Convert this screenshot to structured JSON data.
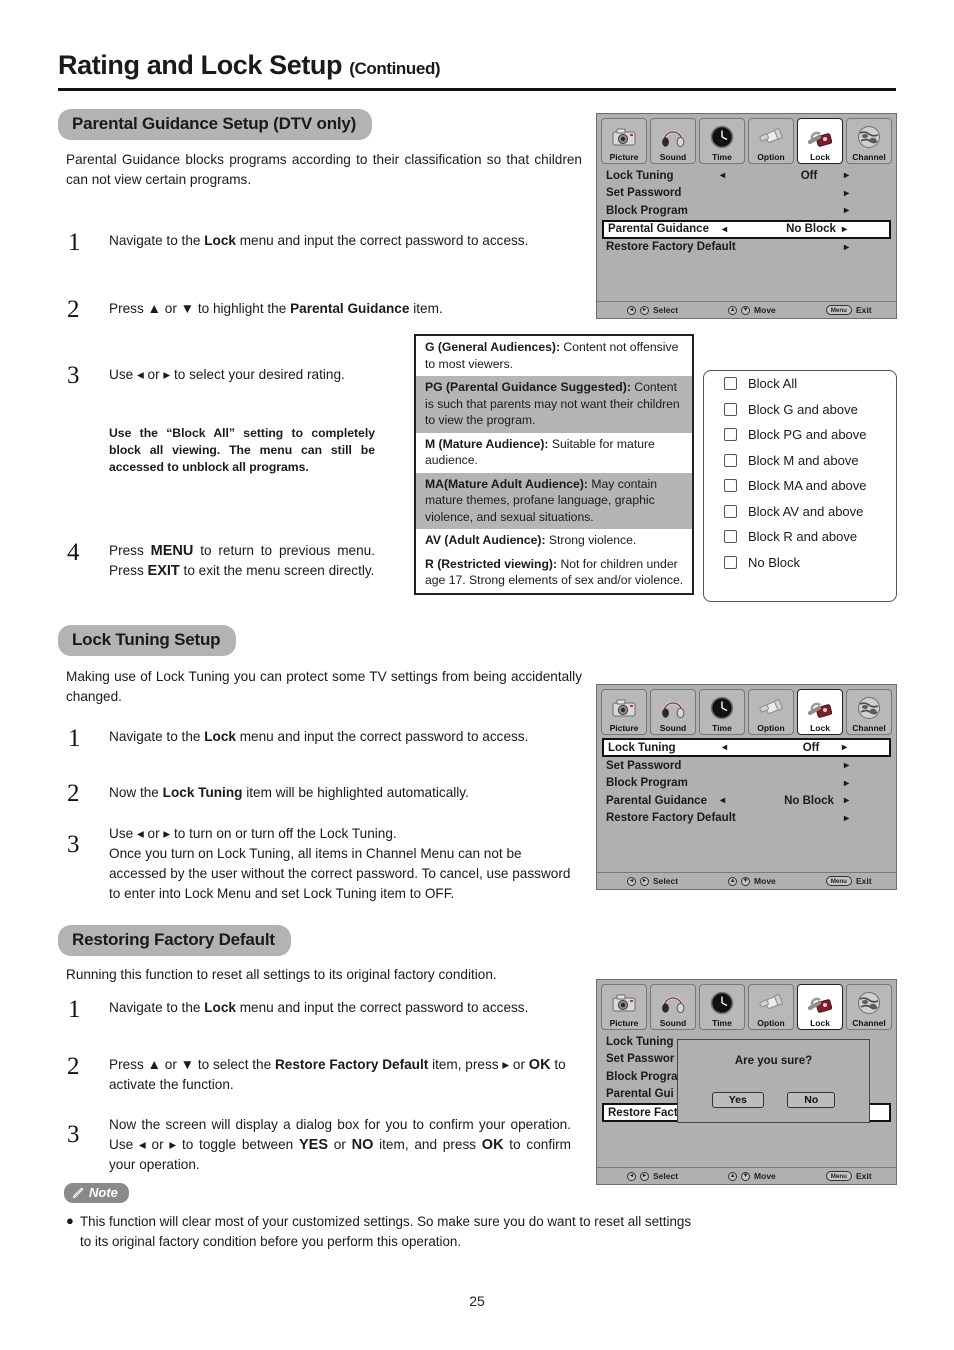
{
  "header": {
    "title": "Rating and Lock Setup",
    "continued": "(Continued)"
  },
  "page_number": "25",
  "sections": {
    "parental": {
      "heading": "Parental Guidance Setup (DTV only)",
      "intro": "Parental Guidance blocks programs according to their classification so that children can not view certain programs.",
      "steps": [
        {
          "num": "1",
          "text_html": "Navigate to the <b>Lock</b> menu and input the correct password to access."
        },
        {
          "num": "2",
          "text_html": "Press ▲ or ▼ to highlight the <b>Parental Guidance</b> item."
        },
        {
          "num": "3",
          "text_html": "Use ◂ or ▸ to select your desired rating."
        },
        {
          "num": "4",
          "text_html": "Press <span class=\"bigb\">MENU</span> to return to previous menu. Press <span class=\"bigb\">EXIT</span> to exit the menu screen directly."
        }
      ],
      "step3_note": "Use the “Block All” setting to completely block all viewing. The menu can still be accessed to unblock all programs."
    },
    "lock_tuning": {
      "heading": "Lock Tuning Setup",
      "intro": "Making use of Lock Tuning you can protect some TV settings from being accidentally changed.",
      "steps": [
        {
          "num": "1",
          "text_html": "Navigate to the <b>Lock</b> menu and input the correct password to access."
        },
        {
          "num": "2",
          "text_html": "Now the <b>Lock Tuning</b> item will be highlighted automatically."
        },
        {
          "num": "3",
          "text_html": "Use ◂ or ▸ to turn on or turn off the Lock Tuning.<br>Once you turn on Lock Tuning, all items in Channel Menu can not be accessed by the user without the correct password. To cancel, use password to enter into Lock Menu and set Lock Tuning item to OFF."
        }
      ]
    },
    "restore": {
      "heading": "Restoring Factory Default",
      "intro": "Running this function to reset all settings to its original factory condition.",
      "steps": [
        {
          "num": "1",
          "text_html": "Navigate to the <b>Lock</b> menu and input the correct password to access."
        },
        {
          "num": "2",
          "text_html": "Press ▲ or ▼ to select the <b>Restore Factory Default</b> item, press ▸ or <span class=\"bigb\">OK</span> to activate the function."
        },
        {
          "num": "3",
          "text_html": "Now the screen will display a dialog box for you to confirm your operation. Use ◂ or ▸ to toggle between <span class=\"bigb\">YES</span> or <span class=\"bigb\">NO</span> item, and press <span class=\"bigb\">OK</span> to confirm your operation."
        }
      ]
    }
  },
  "ratings": [
    {
      "term": "G (General Audiences):",
      "desc": "Content not offensive to most viewers.",
      "shade": false,
      "indent": false
    },
    {
      "term": "PG (Parental Guidance Suggested):",
      "desc": "Content is such that parents may not want their children to view the program.",
      "shade": true,
      "indent": true
    },
    {
      "term": "M (Mature Audience):",
      "desc": "Suitable for mature audience.",
      "shade": false,
      "indent": false
    },
    {
      "term": "MA(Mature Adult Audience):",
      "desc": "May contain mature themes, profane language, graphic violence, and sexual situations.",
      "shade": true,
      "indent": true
    },
    {
      "term": "AV (Adult Audience):",
      "desc": "Strong violence.",
      "shade": false,
      "indent": false
    },
    {
      "term": "R (Restricted viewing):",
      "desc": "Not for children under age 17. Strong elements of sex and/or violence.",
      "shade": false,
      "indent": true
    }
  ],
  "block_options": [
    "Block All",
    "Block G and above",
    "Block PG and above",
    "Block M and above",
    "Block MA and above",
    "Block AV and above",
    "Block R and above",
    "No Block"
  ],
  "osd": {
    "tabs": [
      {
        "label": "Picture",
        "icon": "camera-icon",
        "active": false
      },
      {
        "label": "Sound",
        "icon": "headphones-icon",
        "active": false
      },
      {
        "label": "Time",
        "icon": "clock-icon",
        "active": false
      },
      {
        "label": "Option",
        "icon": "plug-icon",
        "active": false
      },
      {
        "label": "Lock",
        "icon": "padlock-icon",
        "active": true
      },
      {
        "label": "Channel",
        "icon": "globe-icon",
        "active": false
      }
    ],
    "footer": {
      "select_label": "Select",
      "move_label": "Move",
      "exit_label": "Exit",
      "menu_key": "Menu",
      "left_key": "◂",
      "right_key": "▸",
      "up_key": "▲",
      "down_key": "▼"
    },
    "menu1": {
      "rows": [
        {
          "label": "Lock Tuning",
          "value": "Off",
          "arrows": true,
          "chevron": true,
          "highlight": false
        },
        {
          "label": "Set Password",
          "value": "",
          "arrows": false,
          "chevron": true,
          "highlight": false
        },
        {
          "label": "Block Program",
          "value": "",
          "arrows": false,
          "chevron": true,
          "highlight": false
        },
        {
          "label": "Parental Guidance",
          "value": "No Block",
          "arrows": true,
          "chevron": true,
          "highlight": true
        },
        {
          "label": "Restore Factory Default",
          "value": "",
          "arrows": false,
          "chevron": true,
          "highlight": false
        }
      ]
    },
    "menu2": {
      "rows": [
        {
          "label": "Lock Tuning",
          "value": "Off",
          "arrows": true,
          "chevron": true,
          "highlight": true
        },
        {
          "label": "Set Password",
          "value": "",
          "arrows": false,
          "chevron": true,
          "highlight": false
        },
        {
          "label": "Block Program",
          "value": "",
          "arrows": false,
          "chevron": true,
          "highlight": false
        },
        {
          "label": "Parental Guidance",
          "value": "No Block",
          "arrows": true,
          "chevron": true,
          "highlight": false
        },
        {
          "label": "Restore Factory Default",
          "value": "",
          "arrows": false,
          "chevron": true,
          "highlight": false
        }
      ]
    },
    "menu3": {
      "rows": [
        {
          "label": "Lock Tuning",
          "value": "",
          "arrows": false,
          "chevron": false,
          "highlight": false
        },
        {
          "label": "Set Passwor",
          "value": "",
          "arrows": false,
          "chevron": false,
          "highlight": false
        },
        {
          "label": "Block Progra",
          "value": "",
          "arrows": false,
          "chevron": false,
          "highlight": false
        },
        {
          "label": "Parental Gui",
          "value": "",
          "arrows": false,
          "chevron": false,
          "highlight": false
        },
        {
          "label": "Restore Fact",
          "value": "",
          "arrows": false,
          "chevron": false,
          "highlight": true
        }
      ],
      "dialog": {
        "question": "Are you sure?",
        "yes_label": "Yes",
        "no_label": "No"
      }
    }
  },
  "note": {
    "badge": "Note",
    "bullet": "●",
    "text": "This function will clear most of your customized settings.  So make sure you do want to reset all settings to its original factory condition before you perform this operation."
  },
  "colors": {
    "pill_bg": "#b3b3b3",
    "osd_bg": "#b0b0b0",
    "shade_row": "#b5b5b5",
    "note_badge": "#8a8a8a"
  }
}
